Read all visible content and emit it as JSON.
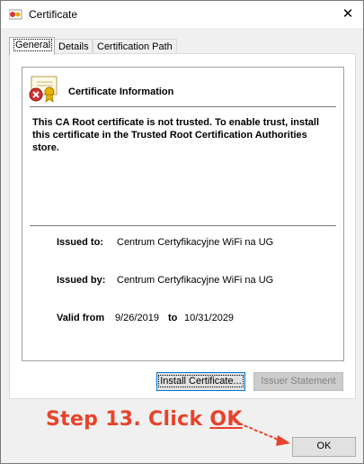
{
  "window": {
    "title": "Certificate"
  },
  "tabs": [
    {
      "label": "General",
      "active": true
    },
    {
      "label": "Details",
      "active": false
    },
    {
      "label": "Certification Path",
      "active": false
    }
  ],
  "info": {
    "heading": "Certificate Information",
    "message": "This CA Root certificate is not trusted. To enable trust, install this certificate in the Trusted Root Certification Authorities store.",
    "issued_to_label": "Issued to:",
    "issued_to_value": "Centrum Certyfikacyjne WiFi na UG",
    "issued_by_label": "Issued by:",
    "issued_by_value": "Centrum Certyfikacyjne WiFi na UG",
    "valid_from_label": "Valid from",
    "valid_from_value": "9/26/2019",
    "valid_to_label": "to",
    "valid_to_value": "10/31/2029"
  },
  "buttons": {
    "install": "Install Certificate...",
    "issuer_statement": "Issuer Statement",
    "ok": "OK"
  },
  "annotation": {
    "prefix": "Step 13. Click ",
    "emphasis": "OK",
    "color": "#e8432b"
  }
}
